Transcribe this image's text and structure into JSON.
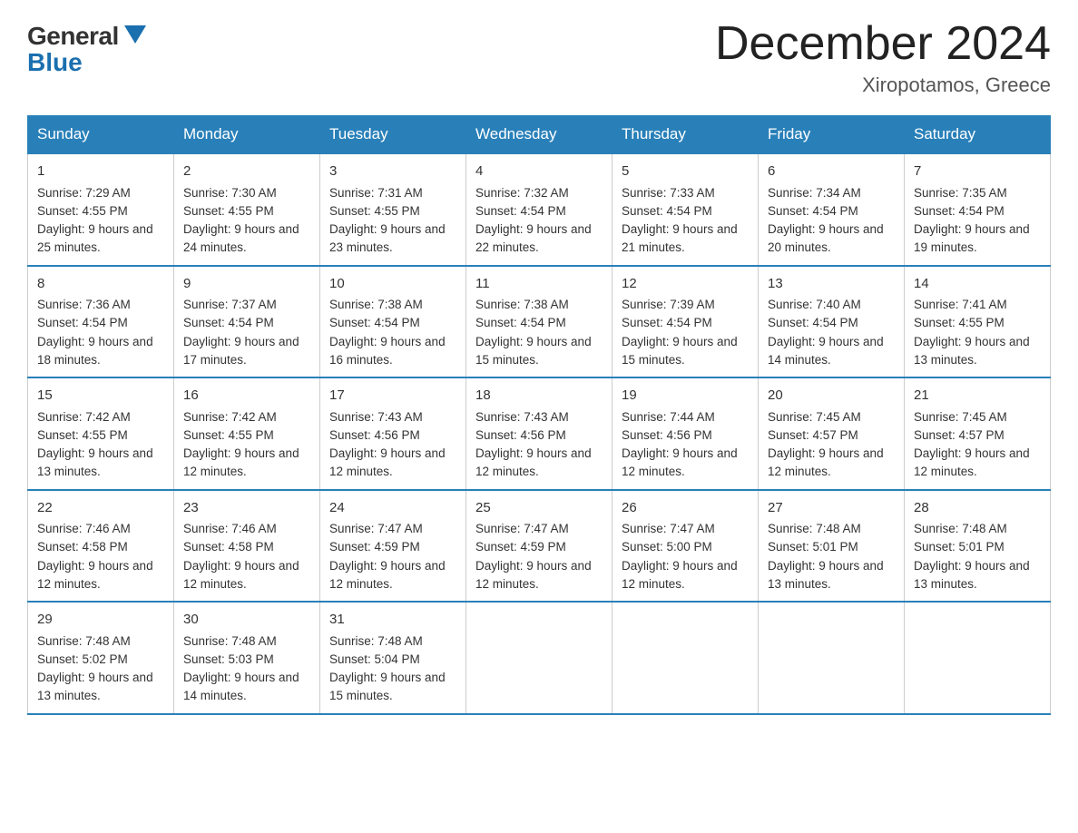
{
  "header": {
    "logo_general": "General",
    "logo_blue": "Blue",
    "month_title": "December 2024",
    "location": "Xiropotamos, Greece"
  },
  "calendar": {
    "days_of_week": [
      "Sunday",
      "Monday",
      "Tuesday",
      "Wednesday",
      "Thursday",
      "Friday",
      "Saturday"
    ],
    "weeks": [
      [
        {
          "day": "1",
          "sunrise": "Sunrise: 7:29 AM",
          "sunset": "Sunset: 4:55 PM",
          "daylight": "Daylight: 9 hours and 25 minutes."
        },
        {
          "day": "2",
          "sunrise": "Sunrise: 7:30 AM",
          "sunset": "Sunset: 4:55 PM",
          "daylight": "Daylight: 9 hours and 24 minutes."
        },
        {
          "day": "3",
          "sunrise": "Sunrise: 7:31 AM",
          "sunset": "Sunset: 4:55 PM",
          "daylight": "Daylight: 9 hours and 23 minutes."
        },
        {
          "day": "4",
          "sunrise": "Sunrise: 7:32 AM",
          "sunset": "Sunset: 4:54 PM",
          "daylight": "Daylight: 9 hours and 22 minutes."
        },
        {
          "day": "5",
          "sunrise": "Sunrise: 7:33 AM",
          "sunset": "Sunset: 4:54 PM",
          "daylight": "Daylight: 9 hours and 21 minutes."
        },
        {
          "day": "6",
          "sunrise": "Sunrise: 7:34 AM",
          "sunset": "Sunset: 4:54 PM",
          "daylight": "Daylight: 9 hours and 20 minutes."
        },
        {
          "day": "7",
          "sunrise": "Sunrise: 7:35 AM",
          "sunset": "Sunset: 4:54 PM",
          "daylight": "Daylight: 9 hours and 19 minutes."
        }
      ],
      [
        {
          "day": "8",
          "sunrise": "Sunrise: 7:36 AM",
          "sunset": "Sunset: 4:54 PM",
          "daylight": "Daylight: 9 hours and 18 minutes."
        },
        {
          "day": "9",
          "sunrise": "Sunrise: 7:37 AM",
          "sunset": "Sunset: 4:54 PM",
          "daylight": "Daylight: 9 hours and 17 minutes."
        },
        {
          "day": "10",
          "sunrise": "Sunrise: 7:38 AM",
          "sunset": "Sunset: 4:54 PM",
          "daylight": "Daylight: 9 hours and 16 minutes."
        },
        {
          "day": "11",
          "sunrise": "Sunrise: 7:38 AM",
          "sunset": "Sunset: 4:54 PM",
          "daylight": "Daylight: 9 hours and 15 minutes."
        },
        {
          "day": "12",
          "sunrise": "Sunrise: 7:39 AM",
          "sunset": "Sunset: 4:54 PM",
          "daylight": "Daylight: 9 hours and 15 minutes."
        },
        {
          "day": "13",
          "sunrise": "Sunrise: 7:40 AM",
          "sunset": "Sunset: 4:54 PM",
          "daylight": "Daylight: 9 hours and 14 minutes."
        },
        {
          "day": "14",
          "sunrise": "Sunrise: 7:41 AM",
          "sunset": "Sunset: 4:55 PM",
          "daylight": "Daylight: 9 hours and 13 minutes."
        }
      ],
      [
        {
          "day": "15",
          "sunrise": "Sunrise: 7:42 AM",
          "sunset": "Sunset: 4:55 PM",
          "daylight": "Daylight: 9 hours and 13 minutes."
        },
        {
          "day": "16",
          "sunrise": "Sunrise: 7:42 AM",
          "sunset": "Sunset: 4:55 PM",
          "daylight": "Daylight: 9 hours and 12 minutes."
        },
        {
          "day": "17",
          "sunrise": "Sunrise: 7:43 AM",
          "sunset": "Sunset: 4:56 PM",
          "daylight": "Daylight: 9 hours and 12 minutes."
        },
        {
          "day": "18",
          "sunrise": "Sunrise: 7:43 AM",
          "sunset": "Sunset: 4:56 PM",
          "daylight": "Daylight: 9 hours and 12 minutes."
        },
        {
          "day": "19",
          "sunrise": "Sunrise: 7:44 AM",
          "sunset": "Sunset: 4:56 PM",
          "daylight": "Daylight: 9 hours and 12 minutes."
        },
        {
          "day": "20",
          "sunrise": "Sunrise: 7:45 AM",
          "sunset": "Sunset: 4:57 PM",
          "daylight": "Daylight: 9 hours and 12 minutes."
        },
        {
          "day": "21",
          "sunrise": "Sunrise: 7:45 AM",
          "sunset": "Sunset: 4:57 PM",
          "daylight": "Daylight: 9 hours and 12 minutes."
        }
      ],
      [
        {
          "day": "22",
          "sunrise": "Sunrise: 7:46 AM",
          "sunset": "Sunset: 4:58 PM",
          "daylight": "Daylight: 9 hours and 12 minutes."
        },
        {
          "day": "23",
          "sunrise": "Sunrise: 7:46 AM",
          "sunset": "Sunset: 4:58 PM",
          "daylight": "Daylight: 9 hours and 12 minutes."
        },
        {
          "day": "24",
          "sunrise": "Sunrise: 7:47 AM",
          "sunset": "Sunset: 4:59 PM",
          "daylight": "Daylight: 9 hours and 12 minutes."
        },
        {
          "day": "25",
          "sunrise": "Sunrise: 7:47 AM",
          "sunset": "Sunset: 4:59 PM",
          "daylight": "Daylight: 9 hours and 12 minutes."
        },
        {
          "day": "26",
          "sunrise": "Sunrise: 7:47 AM",
          "sunset": "Sunset: 5:00 PM",
          "daylight": "Daylight: 9 hours and 12 minutes."
        },
        {
          "day": "27",
          "sunrise": "Sunrise: 7:48 AM",
          "sunset": "Sunset: 5:01 PM",
          "daylight": "Daylight: 9 hours and 13 minutes."
        },
        {
          "day": "28",
          "sunrise": "Sunrise: 7:48 AM",
          "sunset": "Sunset: 5:01 PM",
          "daylight": "Daylight: 9 hours and 13 minutes."
        }
      ],
      [
        {
          "day": "29",
          "sunrise": "Sunrise: 7:48 AM",
          "sunset": "Sunset: 5:02 PM",
          "daylight": "Daylight: 9 hours and 13 minutes."
        },
        {
          "day": "30",
          "sunrise": "Sunrise: 7:48 AM",
          "sunset": "Sunset: 5:03 PM",
          "daylight": "Daylight: 9 hours and 14 minutes."
        },
        {
          "day": "31",
          "sunrise": "Sunrise: 7:48 AM",
          "sunset": "Sunset: 5:04 PM",
          "daylight": "Daylight: 9 hours and 15 minutes."
        },
        null,
        null,
        null,
        null
      ]
    ]
  }
}
